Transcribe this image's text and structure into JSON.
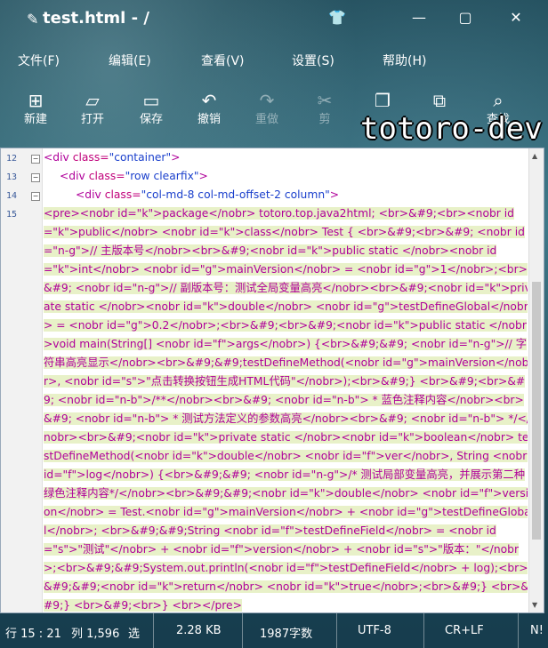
{
  "window": {
    "title": "test.html - /",
    "buttons": [
      "shirt-icon",
      "minimize-icon",
      "maximize-icon",
      "close-icon"
    ]
  },
  "menu": [
    "文件(F)",
    "编辑(E)",
    "查看(V)",
    "设置(S)",
    "帮助(H)"
  ],
  "toolbar": [
    {
      "label": "新建",
      "icon": "new-icon"
    },
    {
      "label": "打开",
      "icon": "open-icon"
    },
    {
      "label": "保存",
      "icon": "save-icon"
    },
    {
      "label": "撤销",
      "icon": "undo-icon"
    },
    {
      "label": "重做",
      "icon": "redo-icon"
    },
    {
      "label": "剪",
      "icon": "cut-icon"
    },
    {
      "label": "",
      "icon": "copy-icon"
    },
    {
      "label": "",
      "icon": "paste-icon"
    },
    {
      "label": "查找",
      "icon": "find-icon"
    }
  ],
  "watermark": "totoro-dev",
  "editor": {
    "line_numbers": [
      "12",
      "13",
      "14",
      "15"
    ],
    "line12": {
      "open": "<div",
      "attr": " class=",
      "val": "\"container\"",
      "close": ">"
    },
    "line13": {
      "open": "<div",
      "attr": " class=",
      "val": "\"row clearfix\"",
      "close": ">"
    },
    "line14": {
      "open": "<div",
      "attr": " class=",
      "val": "\"col-md-8 col-md-offset-2 column\"",
      "close": ">"
    },
    "line15_text": "<pre><nobr id=\"k\">package</nobr> totoro.top.java2html; <br>&#9;<br><nobr id=\"k\">public</nobr> <nobr id=\"k\">class</nobr> Test { <br>&#9;<br>&#9; <nobr id=\"n-g\">// 主版本号</nobr><br>&#9;<nobr id=\"k\">public static </nobr><nobr id=\"k\">int</nobr> <nobr id=\"g\">mainVersion</nobr> = <nobr id=\"g\">1</nobr>;<br>&#9; <nobr id=\"n-g\">// 副版本号：测试全局变量高亮</nobr><br>&#9;<nobr id=\"k\">private static </nobr><nobr id=\"k\">double</nobr> <nobr id=\"g\">testDefineGlobal</nobr> = <nobr id=\"g\">0.2</nobr>;<br>&#9;<br>&#9;<nobr id=\"k\">public static </nobr>void main(String[] <nobr id=\"f\">args</nobr>) {<br>&#9;&#9; <nobr id=\"n-g\">// 字符串高亮显示</nobr><br>&#9;&#9;testDefineMethod(<nobr id=\"g\">mainVersion</nobr>, <nobr id=\"s\">\"点击转换按钮生成HTML代码\"</nobr>);<br>&#9;} <br>&#9;<br>&#9; <nobr id=\"n-b\">/**</nobr><br>&#9; <nobr id=\"n-b\"> * 蓝色注释内容</nobr><br>&#9; <nobr id=\"n-b\"> * 测试方法定义的参数高亮</nobr><br>&#9; <nobr id=\"n-b\"> */</nobr><br>&#9;<nobr id=\"k\">private static </nobr><nobr id=\"k\">boolean</nobr> testDefineMethod(<nobr id=\"k\">double</nobr> <nobr id=\"f\">ver</nobr>, String <nobr id=\"f\">log</nobr>) {<br>&#9;&#9; <nobr id=\"n-g\">/* 测试局部变量高亮，并展示第二种绿色注释内容*/</nobr><br>&#9;&#9;<nobr id=\"k\">double</nobr> <nobr id=\"f\">version</nobr> = Test.<nobr id=\"g\">mainVersion</nobr> + <nobr id=\"g\">testDefineGlobal</nobr>; <br>&#9;&#9;String <nobr id=\"f\">testDefineField</nobr> = <nobr id=\"s\">\"测试\"</nobr> + <nobr id=\"f\">version</nobr> + <nobr id=\"s\">\"版本：\"</nobr>;<br>&#9;&#9;System.out.println(<nobr id=\"f\">testDefineField</nobr> + log);<br>&#9;&#9;<nobr id=\"k\">return</nobr> <nobr id=\"k\">true</nobr>;<br>&#9;} <br>&#9;} <br>&#9;<br>} <br></pre>"
  },
  "status": {
    "position": "行 15 : 21",
    "column": "列 1,596",
    "selection": "选",
    "size": "2.28 KB",
    "chars": "1987字数",
    "encoding": "UTF-8",
    "eol": "CR+LF",
    "extra": "N!"
  }
}
